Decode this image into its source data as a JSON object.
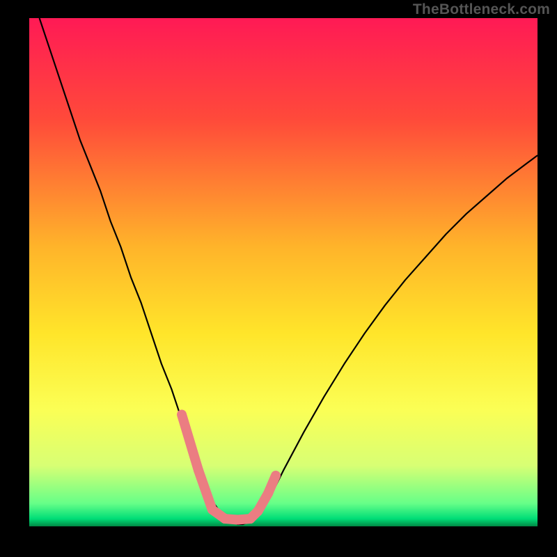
{
  "watermark": "TheBottleneck.com",
  "colors": {
    "background": "#000000",
    "gradient_stops": [
      {
        "offset": 0.0,
        "color": "#ff1a55"
      },
      {
        "offset": 0.2,
        "color": "#ff4a3a"
      },
      {
        "offset": 0.45,
        "color": "#ffb42a"
      },
      {
        "offset": 0.62,
        "color": "#ffe52a"
      },
      {
        "offset": 0.77,
        "color": "#fbff55"
      },
      {
        "offset": 0.88,
        "color": "#d8ff74"
      },
      {
        "offset": 0.955,
        "color": "#66ff88"
      },
      {
        "offset": 0.985,
        "color": "#00dd77"
      },
      {
        "offset": 1.0,
        "color": "#008844"
      }
    ],
    "curve": "#000000",
    "overlay_pink": "#eb7d82"
  },
  "chart_data": {
    "type": "line",
    "title": "",
    "xlabel": "",
    "ylabel": "",
    "xlim": [
      0,
      100
    ],
    "ylim": [
      0,
      100
    ],
    "series": [
      {
        "name": "bottleneck-curve",
        "x": [
          2,
          5,
          8,
          10,
          12,
          14,
          16,
          18,
          20,
          22,
          24,
          26,
          28,
          30,
          32,
          33,
          34,
          36,
          38,
          40,
          41,
          42,
          44,
          46,
          48,
          50,
          54,
          58,
          62,
          66,
          70,
          74,
          78,
          82,
          86,
          90,
          94,
          98,
          100
        ],
        "y": [
          100,
          91,
          82,
          76,
          71,
          66,
          60,
          55,
          49,
          44,
          38,
          32,
          27,
          21,
          15,
          12,
          9.5,
          5,
          2.2,
          0.8,
          0.4,
          0.4,
          1.2,
          3.5,
          7,
          11,
          18.5,
          25.5,
          32,
          38,
          43.5,
          48.5,
          53,
          57.5,
          61.5,
          65,
          68.5,
          71.5,
          73
        ]
      }
    ],
    "overlay_segments": [
      {
        "x0": 30,
        "y0": 22,
        "x1": 33.3,
        "y1": 11
      },
      {
        "x0": 33.3,
        "y0": 11,
        "x1": 36,
        "y1": 3.3
      },
      {
        "x0": 36,
        "y0": 3.3,
        "x1": 38.5,
        "y1": 1.5
      },
      {
        "x0": 38.5,
        "y0": 1.5,
        "x1": 41,
        "y1": 1.3
      },
      {
        "x0": 41,
        "y0": 1.3,
        "x1": 43.5,
        "y1": 1.5
      },
      {
        "x0": 43.5,
        "y0": 1.5,
        "x1": 45,
        "y1": 3
      },
      {
        "x0": 45,
        "y0": 3,
        "x1": 47,
        "y1": 6.5
      },
      {
        "x0": 47,
        "y0": 6.5,
        "x1": 48.5,
        "y1": 10
      }
    ]
  }
}
